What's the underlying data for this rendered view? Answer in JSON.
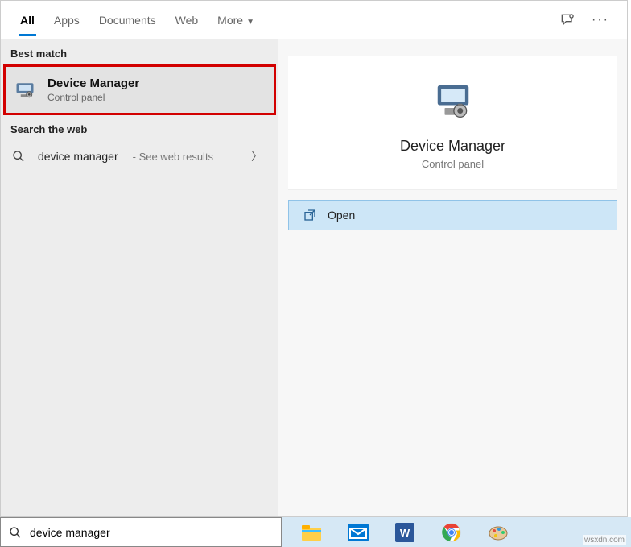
{
  "tabs": {
    "all": "All",
    "apps": "Apps",
    "documents": "Documents",
    "web": "Web",
    "more": "More"
  },
  "sections": {
    "best_match": "Best match",
    "search_web": "Search the web"
  },
  "result": {
    "title": "Device Manager",
    "subtitle": "Control panel"
  },
  "web_search": {
    "query": "device manager",
    "hint": "- See web results"
  },
  "preview": {
    "title": "Device Manager",
    "subtitle": "Control panel"
  },
  "action": {
    "open": "Open"
  },
  "search": {
    "value": "device manager"
  },
  "watermark": "wsxdn.com"
}
